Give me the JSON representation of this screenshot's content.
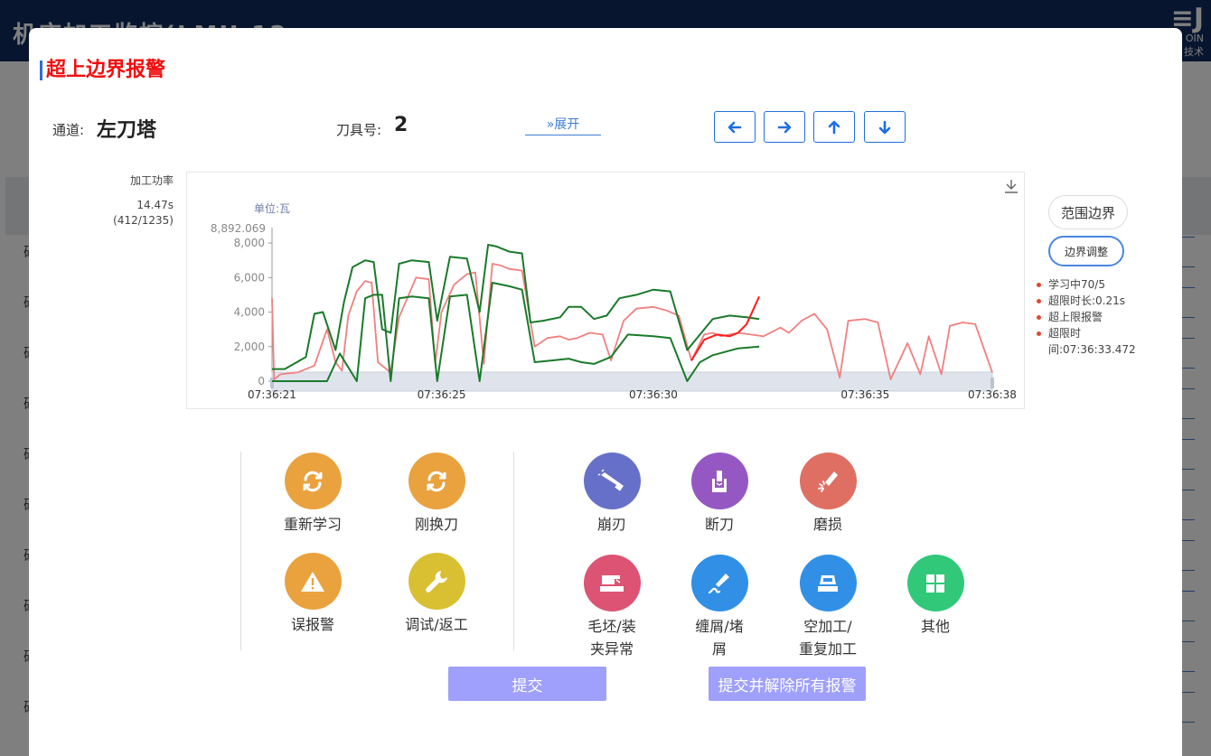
{
  "background": {
    "app_title": "机床加工监控(LMU-12",
    "logo_text": "OIN",
    "logo_sub": "技术",
    "row_letters": [
      "硬",
      "硬",
      "硬",
      "硬",
      "硬",
      "硬",
      "硬",
      "硬",
      "硬",
      "硬"
    ]
  },
  "modal": {
    "title": "超上边界报警",
    "channel_label": "通道:",
    "channel_value": "左刀塔",
    "tool_label": "刀具号:",
    "tool_value": "2",
    "expand_label": "»展开",
    "nav": {
      "left": "arrow-left-icon",
      "right": "arrow-right-icon",
      "up": "arrow-up-icon",
      "down": "arrow-down-icon"
    }
  },
  "metric": {
    "name": "加工功率",
    "time": "14.47s",
    "position": "(412/1235)"
  },
  "chart_data": {
    "type": "line",
    "unit_label": "单位:瓦",
    "max_label": "8,892.069",
    "y_ticks": [
      "8,000",
      "6,000",
      "4,000",
      "2,000",
      "0"
    ],
    "x_ticks": [
      "07:36:21",
      "07:36:25",
      "07:36:30",
      "07:36:35",
      "07:36:38"
    ],
    "ylim": [
      0,
      8892.069
    ],
    "xlim": [
      0,
      17
    ],
    "series": [
      {
        "color": "#f08080",
        "x": [
          0,
          0.05,
          0.2,
          0.6,
          1.0,
          1.3,
          1.5,
          1.65,
          1.8,
          2.0,
          2.2,
          2.35,
          2.5,
          2.8,
          3.0,
          3.4,
          3.7,
          3.85,
          4.0,
          4.3,
          4.6,
          4.8,
          5.0,
          5.2,
          5.4,
          5.6,
          5.9,
          6.2,
          6.5,
          6.8,
          7.0,
          7.2,
          7.5,
          7.8,
          8.0,
          8.3,
          8.6,
          9.0,
          9.3,
          9.6,
          9.9,
          10.2,
          10.4,
          10.6,
          10.8,
          11.0,
          11.3,
          11.6,
          12.0,
          12.2,
          12.5,
          12.8,
          13.1,
          13.4,
          13.6,
          14.0,
          14.3,
          14.6,
          15.0,
          15.3,
          15.5,
          15.8,
          16.0,
          16.3,
          16.6,
          17.0
        ],
        "values": [
          4800,
          100,
          400,
          500,
          900,
          3000,
          1100,
          600,
          3800,
          5200,
          5800,
          5700,
          1100,
          500,
          3700,
          6000,
          5900,
          1000,
          4000,
          5600,
          6200,
          6300,
          1000,
          6800,
          6700,
          6500,
          6400,
          2000,
          2500,
          2600,
          2400,
          2500,
          2800,
          2700,
          1200,
          3500,
          4200,
          4300,
          4100,
          3800,
          1200,
          2700,
          2800,
          2600,
          2700,
          2800,
          2700,
          2600,
          3100,
          2800,
          3500,
          3900,
          3000,
          200,
          3500,
          3600,
          3400,
          100,
          2200,
          400,
          2600,
          400,
          3200,
          3400,
          3300,
          500
        ]
      },
      {
        "color": "#1a7a2a",
        "name": "",
        "x": [
          0,
          0.3,
          0.8,
          1.0,
          1.2,
          1.5,
          1.7,
          1.9,
          2.2,
          2.4,
          2.6,
          2.8,
          3.0,
          3.3,
          3.7,
          3.9,
          4.2,
          4.6,
          4.9,
          5.1,
          5.3,
          5.6,
          5.9,
          6.1,
          6.4,
          6.8,
          7.0,
          7.3,
          7.6,
          7.9,
          8.2,
          8.6,
          9.0,
          9.4,
          9.8,
          10.1,
          10.4,
          10.8,
          11.2,
          11.5
        ],
        "values": [
          700,
          700,
          1400,
          3900,
          4000,
          1800,
          4600,
          6600,
          7000,
          6900,
          3000,
          2800,
          6800,
          7000,
          6900,
          3500,
          7200,
          7100,
          4000,
          7900,
          7800,
          7500,
          7400,
          3400,
          3500,
          3700,
          4300,
          4300,
          3600,
          3800,
          4800,
          5000,
          5300,
          5200,
          1800,
          2700,
          3600,
          3800,
          3700,
          3600
        ]
      },
      {
        "color": "#1a7a2a",
        "name": "",
        "x": [
          0,
          0.5,
          1.3,
          1.6,
          2.0,
          2.2,
          2.4,
          2.6,
          2.8,
          3.0,
          3.3,
          3.7,
          3.9,
          4.2,
          4.6,
          4.9,
          5.2,
          5.6,
          5.9,
          6.2,
          6.6,
          7.0,
          7.3,
          7.6,
          8.0,
          8.4,
          9.0,
          9.4,
          9.8,
          10.1,
          10.4,
          11.0,
          11.5
        ],
        "values": [
          0,
          0,
          0,
          1600,
          0,
          4800,
          5000,
          5000,
          0,
          4800,
          4900,
          4800,
          0,
          4900,
          5000,
          0,
          5700,
          5500,
          5300,
          1100,
          1200,
          1300,
          1100,
          1000,
          1400,
          2700,
          2600,
          2500,
          0,
          1100,
          1500,
          1900,
          2000
        ]
      },
      {
        "color": "#ff1a1a",
        "name": "",
        "x": [
          9.9,
          10.2,
          10.5,
          10.8,
          11.0,
          11.2,
          11.5
        ],
        "values": [
          1200,
          2400,
          2700,
          2600,
          2800,
          3300,
          4900
        ]
      }
    ]
  },
  "side_panel": {
    "range_button": "范围边界",
    "adjust_button": "边界调整",
    "status": [
      "学习中70/5",
      "超限时长:0.21s",
      "超上限报警",
      "超限时间:07:36:33.472"
    ]
  },
  "actions_left": [
    {
      "label": "重新学习",
      "icon": "refresh-icon",
      "color": "#eaa23e"
    },
    {
      "label": "刚换刀",
      "icon": "refresh-icon",
      "color": "#eaa23e"
    },
    {
      "label": "误报警",
      "icon": "warning-icon",
      "color": "#eaa23e"
    },
    {
      "label": "调试/返工",
      "icon": "wrench-icon",
      "color": "#d9c032"
    }
  ],
  "actions_right": [
    {
      "label": "崩刃",
      "icon": "chipped-edge-icon",
      "color": "#6670c8"
    },
    {
      "label": "断刀",
      "icon": "broken-tool-icon",
      "color": "#9558c3"
    },
    {
      "label": "磨损",
      "icon": "wear-icon",
      "color": "#df6f63"
    },
    {
      "label": "毛坯/装\n夹异常",
      "icon": "fixture-icon",
      "color": "#dc5374"
    },
    {
      "label": "缠屑/堵\n屑",
      "icon": "chip-tangle-icon",
      "color": "#3190e6"
    },
    {
      "label": "空加工/\n重复加工",
      "icon": "empty-cut-icon",
      "color": "#3190e6"
    },
    {
      "label": "其他",
      "icon": "grid-icon",
      "color": "#31c87a"
    }
  ],
  "buttons": {
    "submit": "提交",
    "submit_clear": "提交并解除所有报警"
  }
}
